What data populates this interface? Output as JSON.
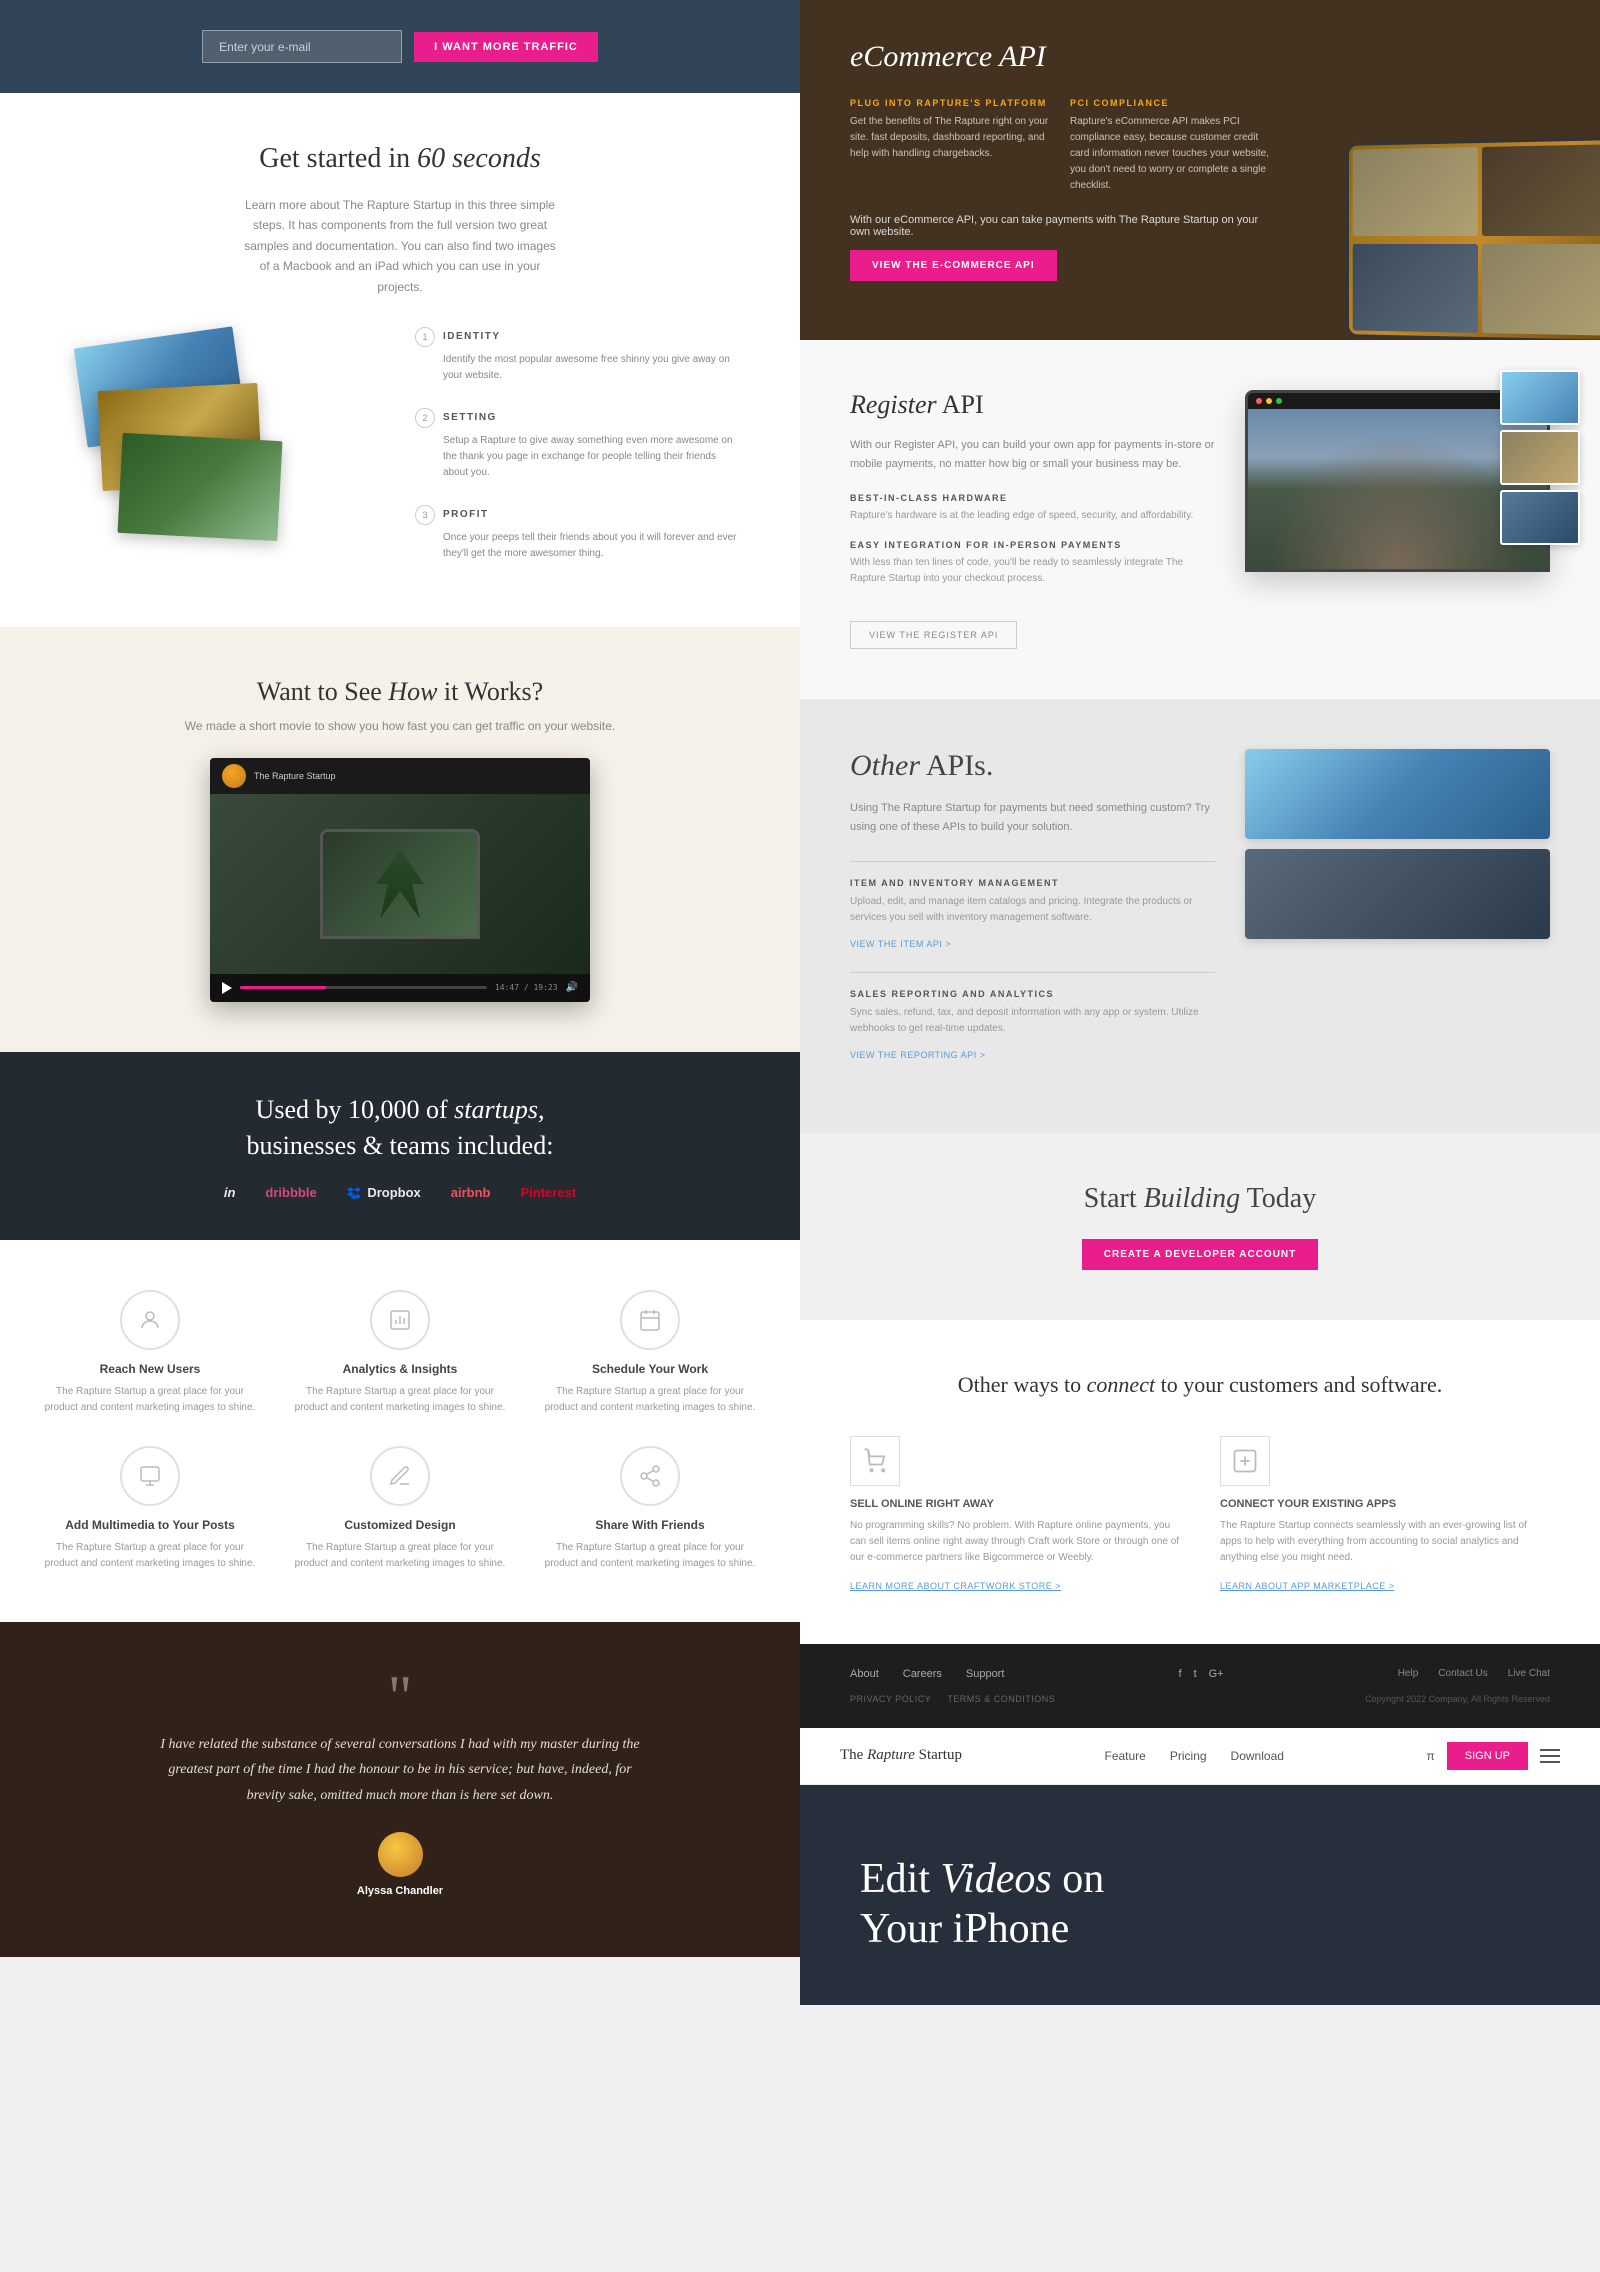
{
  "left": {
    "hero": {
      "email_placeholder": "Enter your e-mail",
      "cta_button": "I WANT MORE TRAFFIC"
    },
    "get_started": {
      "heading": "Get started in",
      "heading_em": "60 seconds",
      "subtitle": "Learn more about The Rapture Startup in this three simple steps. It has components from the full version two great samples and documentation. You can also find two images of a Macbook and an iPad which you can use in your projects.",
      "steps": [
        {
          "number": "1",
          "title": "IDENTITY",
          "desc": "Identify the most popular awesome free shinny you give away on your website."
        },
        {
          "number": "2",
          "title": "SETTING",
          "desc": "Setup a Rapture to give away something even more awesome on the thank you page in exchange for people telling their friends about you."
        },
        {
          "number": "3",
          "title": "PROFIT",
          "desc": "Once your peeps tell their friends about you it will forever and ever they'll get the more awesomer thing."
        }
      ]
    },
    "how_works": {
      "heading": "Want to See",
      "heading_em": "How",
      "heading_rest": "it Works?",
      "subtitle": "We made a short movie to show you how fast you can get traffic on your website.",
      "channel_name": "The Rapture Startup",
      "video_time": "14:47 / 19:23"
    },
    "social_proof": {
      "heading": "Used by 10,000 of",
      "heading_em": "startups,",
      "heading_rest": "businesses & teams included:",
      "brands": [
        "InVision",
        "dribbble",
        "Dropbox",
        "airbnb",
        "Pinterest"
      ]
    },
    "features": [
      {
        "icon": "👤",
        "title": "Reach New Users",
        "desc": "The Rapture Startup a great place for your product and content marketing images to shine."
      },
      {
        "icon": "📊",
        "title": "Analytics & Insights",
        "desc": "The Rapture Startup a great place for your product and content marketing images to shine."
      },
      {
        "icon": "📅",
        "title": "Schedule Your Work",
        "desc": "The Rapture Startup a great place for your product and content marketing images to shine."
      },
      {
        "icon": "🖼",
        "title": "Add Multimedia to Your Posts",
        "desc": "The Rapture Startup a great place for your product and content marketing images to shine."
      },
      {
        "icon": "✏️",
        "title": "Customized Design",
        "desc": "The Rapture Startup a great place for your product and content marketing images to shine."
      },
      {
        "icon": "🔗",
        "title": "Share With Friends",
        "desc": "The Rapture Startup a great place for your product and content marketing images to shine."
      }
    ],
    "testimonial": {
      "quote": "I have related the substance of several conversations I had with my master during the greatest part of the time I had the honour to be in his service; but have, indeed, for brevity sake, omitted much more than is here set down.",
      "author": "Alyssa Chandler"
    }
  },
  "right": {
    "ecommerce": {
      "title": "eCommerce API",
      "plug_title": "PLUG INTO RAPTURE'S PLATFORM",
      "plug_desc": "Get the benefits of The Rapture right on your site. fast deposits, dashboard reporting, and help with handling chargebacks.",
      "pci_title": "PCI COMPLIANCE",
      "pci_desc": "Rapture's eCommerce API makes PCI compliance easy, because customer credit card information never touches your website, you don't need to worry or complete a single checklist.",
      "cta_text": "With our eCommerce API, you can take payments with The Rapture Startup on your own website.",
      "cta_button": "VIEW THE E-COMMERCE API"
    },
    "register_api": {
      "title": "Register",
      "title_rest": " API",
      "desc": "With our Register API, you can build your own app for payments in-store or mobile payments, no matter how big or small your business may be.",
      "features": [
        {
          "title": "BEST-IN-CLASS HARDWARE",
          "desc": "Rapture's hardware is at the leading edge of speed, security, and affordability."
        },
        {
          "title": "EASY INTEGRATION FOR IN-PERSON PAYMENTS",
          "desc": "With less than ten lines of code, you'll be ready to seamlessly integrate The Rapture Startup into your checkout process."
        }
      ],
      "cta_button": "VIEW THE REGISTER API"
    },
    "other_apis": {
      "title": "Other",
      "title_em": " APIs.",
      "subtitle": "Using The Rapture Startup for payments but need something custom? Try using one of these APIs to build your solution.",
      "features": [
        {
          "title": "ITEM AND INVENTORY MANAGEMENT",
          "desc": "Upload, edit, and manage item catalogs and pricing. Integrate the products or services you sell with inventory management software.",
          "link": "VIEW THE ITEM API >"
        },
        {
          "title": "SALES REPORTING AND ANALYTICS",
          "desc": "Sync sales, refund, tax, and deposit information with any app or system. Utilize webhooks to get real-time updates.",
          "link": "VIEW THE REPORTING API >"
        }
      ]
    },
    "start_building": {
      "heading": "Start",
      "heading_em": " Building",
      "heading_rest": " Today",
      "cta_button": "CREATE A DEVELOPER ACCOUNT"
    },
    "connect": {
      "heading": "Other ways to",
      "heading_em": " connect",
      "heading_rest": " to your customers and software.",
      "items": [
        {
          "icon": "🛒",
          "title": "SELL ONLINE RIGHT AWAY",
          "desc": "No programming skills? No problem. With Rapture online payments, you can sell items online right away through Craft work Store or through one of our e-commerce partners like Bigcommerce or Weebly.",
          "link": "LEARN MORE ABOUT CRAFTWORK STORE >"
        },
        {
          "icon": "⚙️",
          "title": "CONNECT YOUR EXISTING APPS",
          "desc": "The Rapture Startup connects seamlessly with an ever-growing list of apps to help with everything from accounting to social analytics and anything else you might need.",
          "link": "LEARN ABOUT APP MARKETPLACE >"
        }
      ]
    },
    "footer": {
      "nav_links": [
        "About",
        "Careers",
        "Support"
      ],
      "social_links": [
        "f",
        "t",
        "G+"
      ],
      "right_links": [
        "Help",
        "Contact Us",
        "Live Chat"
      ],
      "legal_links": [
        "Privacy Policy",
        "Terms & Conditions"
      ],
      "copyright": "Copyright 2022 Company, All Rights Reserved"
    },
    "startup_nav": {
      "logo": "The Rapture Startup",
      "nav_links": [
        "Feature",
        "Pricing",
        "Download"
      ],
      "pi_symbol": "π",
      "signup_button": "SIGN UP"
    },
    "video_hero": {
      "heading": "Edit",
      "heading_em": " Videos",
      "heading_rest": " on",
      "heading_line2": "Your iPhone"
    }
  }
}
